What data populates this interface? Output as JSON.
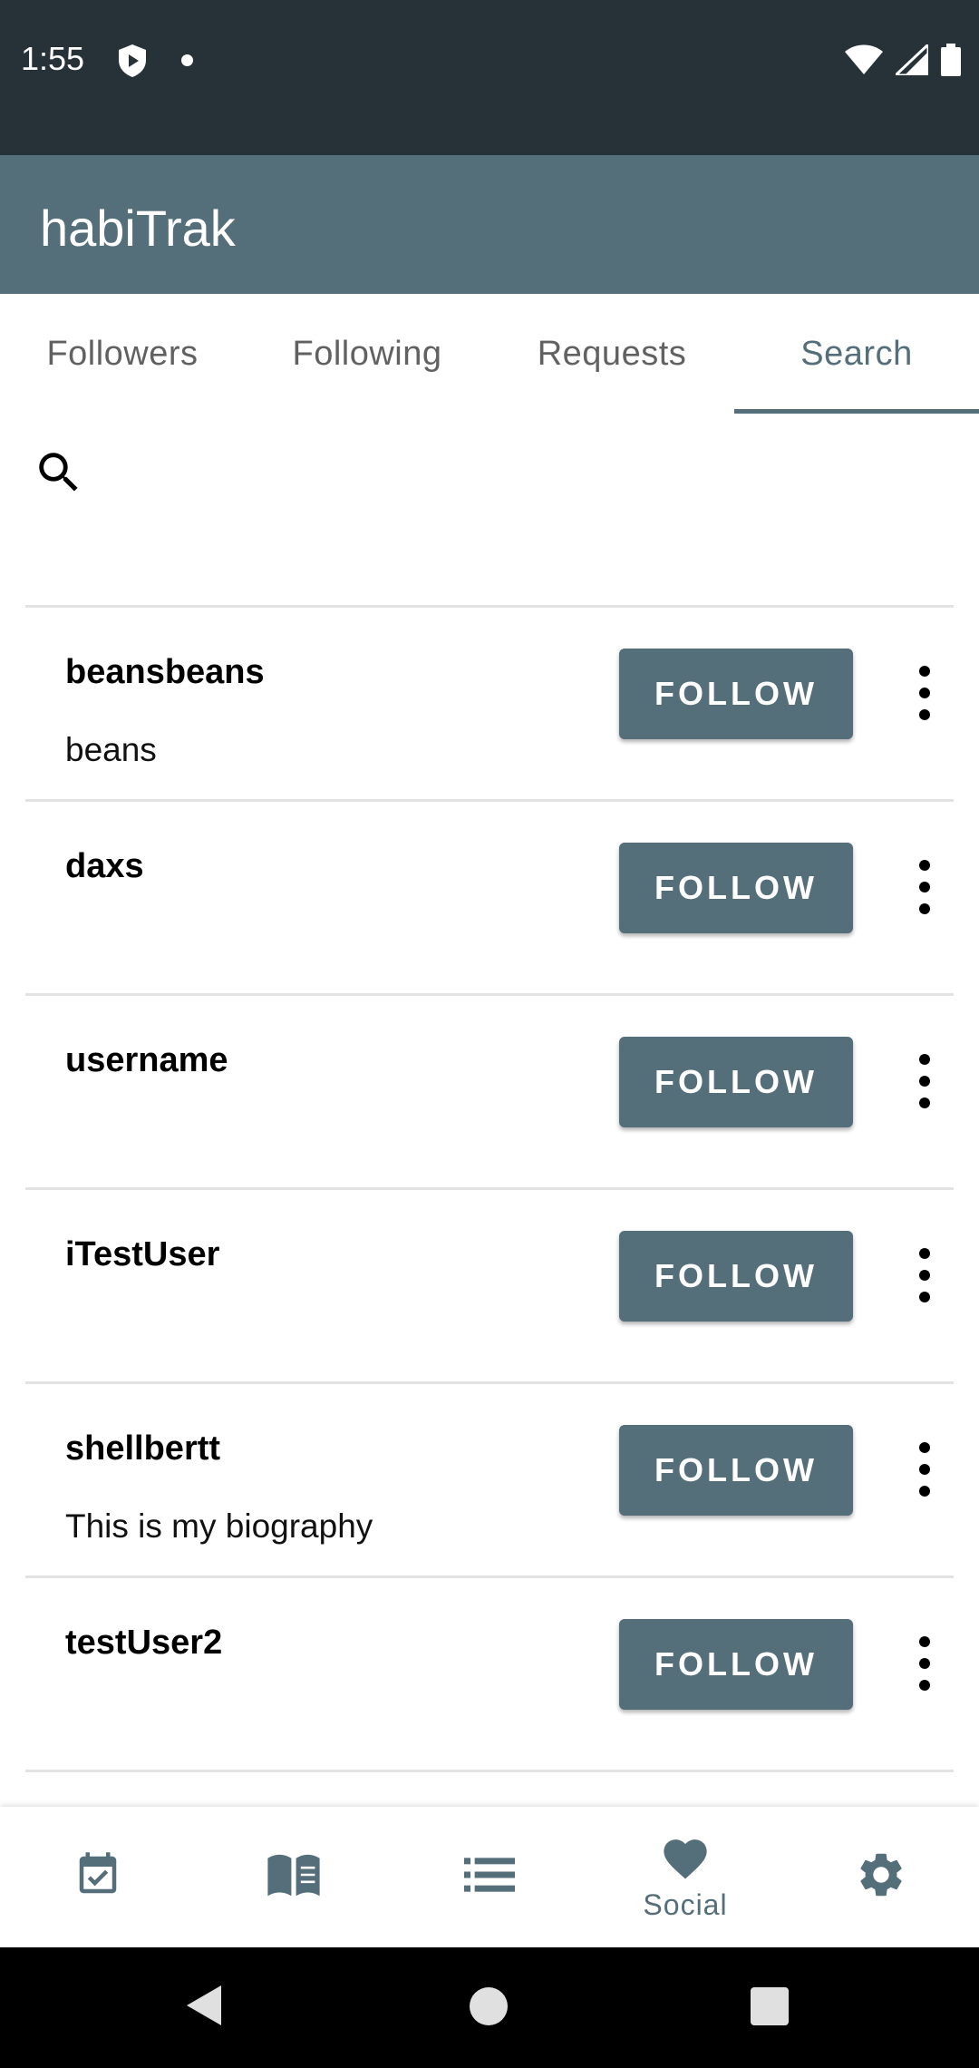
{
  "status_bar": {
    "time": "1:55"
  },
  "app": {
    "title": "habiTrak"
  },
  "tabs": [
    {
      "label": "Followers",
      "active": false
    },
    {
      "label": "Following",
      "active": false
    },
    {
      "label": "Requests",
      "active": false
    },
    {
      "label": "Search",
      "active": true
    }
  ],
  "search": {
    "value": "",
    "icon": "search-icon"
  },
  "users": [
    {
      "username": "beansbeans",
      "bio": "beans",
      "button": "FOLLOW"
    },
    {
      "username": "daxs",
      "bio": "",
      "button": "FOLLOW"
    },
    {
      "username": "username",
      "bio": "",
      "button": "FOLLOW"
    },
    {
      "username": "iTestUser",
      "bio": "",
      "button": "FOLLOW"
    },
    {
      "username": "shellbertt",
      "bio": "This is my biography",
      "button": "FOLLOW"
    },
    {
      "username": "testUser2",
      "bio": "",
      "button": "FOLLOW"
    }
  ],
  "bottom_nav": {
    "items": [
      {
        "icon": "calendar-check-icon",
        "label": ""
      },
      {
        "icon": "book-open-icon",
        "label": ""
      },
      {
        "icon": "list-icon",
        "label": ""
      },
      {
        "icon": "heart-icon",
        "label": "Social",
        "active": true
      },
      {
        "icon": "gear-icon",
        "label": ""
      }
    ]
  },
  "colors": {
    "primary": "#546e7a",
    "status_bar": "#263238"
  }
}
